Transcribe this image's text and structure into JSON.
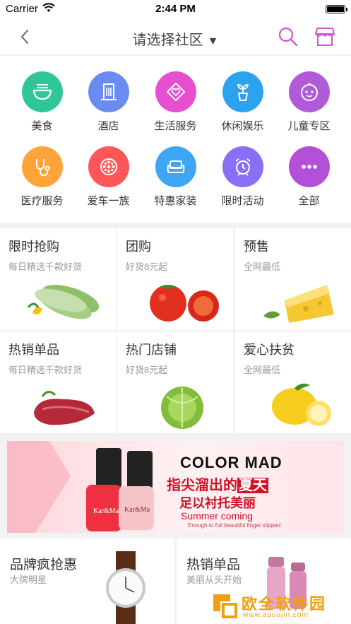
{
  "status_bar": {
    "carrier": "Carrier",
    "time": "2:44 PM"
  },
  "nav": {
    "title": "请选择社区",
    "caret": "▼",
    "back_icon": "chevron-left-icon",
    "search_icon": "search-icon",
    "shop_icon": "store-icon",
    "accent": "#c85bc8"
  },
  "categories": [
    {
      "label": "美食",
      "icon": "noodle-bowl-icon",
      "color": "#2fc79a"
    },
    {
      "label": "酒店",
      "icon": "building-icon",
      "color": "#6a8cf0"
    },
    {
      "label": "生活服务",
      "icon": "heart-tag-icon",
      "color": "#e64fd0"
    },
    {
      "label": "休闲娱乐",
      "icon": "plant-icon",
      "color": "#2ba3ee"
    },
    {
      "label": "儿童专区",
      "icon": "baby-face-icon",
      "color": "#b05ad8"
    },
    {
      "label": "医疗服务",
      "icon": "stethoscope-icon",
      "color": "#ffa33a"
    },
    {
      "label": "爱车一族",
      "icon": "wheel-icon",
      "color": "#ff5757"
    },
    {
      "label": "特惠家装",
      "icon": "sofa-icon",
      "color": "#3fa6f5"
    },
    {
      "label": "限时活动",
      "icon": "alarm-clock-icon",
      "color": "#8a6ef5"
    },
    {
      "label": "全部",
      "icon": "more-dots-icon",
      "color": "#b44fd8"
    }
  ],
  "promos": [
    {
      "title": "限时抢购",
      "subtitle": "每日精选千款好货",
      "image": "zucchini"
    },
    {
      "title": "团购",
      "subtitle": "好货8元起",
      "image": "tomato"
    },
    {
      "title": "预售",
      "subtitle": "全网最低",
      "image": "cheese"
    },
    {
      "title": "热销单品",
      "subtitle": "每日精选千款好货",
      "image": "beef"
    },
    {
      "title": "热门店铺",
      "subtitle": "好货8元起",
      "image": "cabbage"
    },
    {
      "title": "爱心扶贫",
      "subtitle": "全网最低",
      "image": "lemon"
    }
  ],
  "banner": {
    "brand": "COLOR MAD",
    "line1_a": "指尖溜出的",
    "line1_b": "夏天",
    "line2": "足以衬托美丽",
    "line3": "Summer coming",
    "line4": "Enough to foil beautiful finger slipped",
    "bottle_label": "Kar&Ma"
  },
  "bottom_cards": [
    {
      "title": "品牌疯抢惠",
      "subtitle": "大牌明星"
    },
    {
      "title": "热销单品",
      "subtitle": "美丽从头开始"
    }
  ],
  "watermark": {
    "text": "欧全软件园",
    "url": "www.apoujin.com"
  }
}
